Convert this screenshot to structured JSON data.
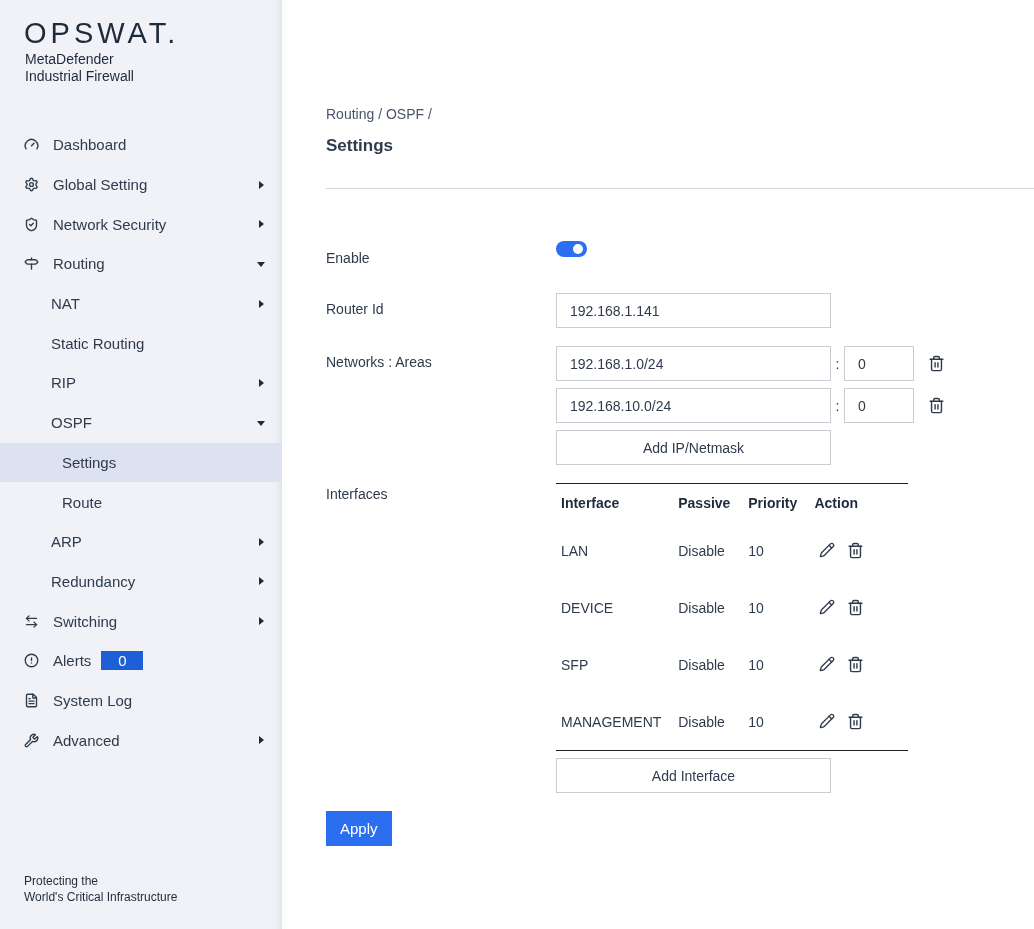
{
  "brand": {
    "logo": "OPSWAT.",
    "product": [
      "MetaDefender",
      "Industrial Firewall"
    ],
    "tagline": [
      "Protecting the",
      "World's Critical Infrastructure"
    ]
  },
  "nav": [
    {
      "label": "Dashboard",
      "kind": "link",
      "selected": false
    },
    {
      "label": "Global Setting",
      "kind": "group",
      "expanded": false,
      "selected": false
    },
    {
      "label": "Network Security",
      "kind": "group",
      "expanded": false,
      "selected": false
    },
    {
      "label": "Routing",
      "kind": "group",
      "expanded": true,
      "selected": false,
      "children": [
        {
          "label": "NAT",
          "kind": "group",
          "expanded": false,
          "selected": false
        },
        {
          "label": "Static Routing",
          "kind": "link",
          "selected": false
        },
        {
          "label": "RIP",
          "kind": "group",
          "expanded": false,
          "selected": false
        },
        {
          "label": "OSPF",
          "kind": "group",
          "expanded": true,
          "selected": false,
          "children": [
            {
              "label": "Settings",
              "kind": "link",
              "selected": true
            },
            {
              "label": "Route",
              "kind": "link",
              "selected": false
            }
          ]
        },
        {
          "label": "ARP",
          "kind": "group",
          "expanded": false,
          "selected": false
        },
        {
          "label": "Redundancy",
          "kind": "group",
          "expanded": false,
          "selected": false
        }
      ]
    },
    {
      "label": "Switching",
      "kind": "group",
      "expanded": false,
      "selected": false
    },
    {
      "label": "Alerts",
      "kind": "link",
      "selected": false,
      "badge": "0"
    },
    {
      "label": "System Log",
      "kind": "link",
      "selected": false
    },
    {
      "label": "Advanced",
      "kind": "group",
      "expanded": false,
      "selected": false
    }
  ],
  "breadcrumb": "Routing / OSPF /",
  "title": "Settings",
  "form": {
    "enable": {
      "label": "Enable",
      "on": true
    },
    "router_id": {
      "label": "Router Id",
      "value": "192.168.1.141"
    },
    "networks": {
      "label": "Networks : Areas",
      "separator": ":",
      "rows": [
        {
          "network": "192.168.1.0/24",
          "area": "0"
        },
        {
          "network": "192.168.10.0/24",
          "area": "0"
        }
      ],
      "add_button": "Add IP/Netmask"
    },
    "interfaces": {
      "label": "Interfaces",
      "columns": [
        "Interface",
        "Passive",
        "Priority",
        "Action"
      ],
      "rows": [
        {
          "interface": "LAN",
          "passive": "Disable",
          "priority": "10"
        },
        {
          "interface": "DEVICE",
          "passive": "Disable",
          "priority": "10"
        },
        {
          "interface": "SFP",
          "passive": "Disable",
          "priority": "10"
        },
        {
          "interface": "MANAGEMENT",
          "passive": "Disable",
          "priority": "10"
        }
      ],
      "add_button": "Add Interface"
    }
  },
  "apply_button": "Apply"
}
